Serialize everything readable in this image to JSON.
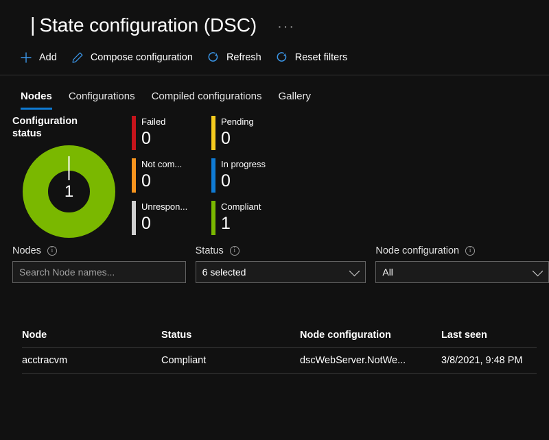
{
  "header": {
    "pipe": "|",
    "title": "State configuration (DSC)",
    "more_menu": "···"
  },
  "toolbar": {
    "items": [
      {
        "label": "Add",
        "icon": "plus-icon"
      },
      {
        "label": "Compose configuration",
        "icon": "pencil-icon"
      },
      {
        "label": "Refresh",
        "icon": "refresh-icon"
      },
      {
        "label": "Reset filters",
        "icon": "reset-icon"
      }
    ]
  },
  "tabs": [
    {
      "label": "Nodes",
      "active": true
    },
    {
      "label": "Configurations",
      "active": false
    },
    {
      "label": "Compiled configurations",
      "active": false
    },
    {
      "label": "Gallery",
      "active": false
    }
  ],
  "status_panel": {
    "heading": "Configuration status",
    "center_value": "1",
    "legend": [
      {
        "label": "Failed",
        "value": "0",
        "color": "#c5141b"
      },
      {
        "label": "Pending",
        "value": "0",
        "color": "#f5cb1e"
      },
      {
        "label": "Not com...",
        "value": "0",
        "color": "#f7941e"
      },
      {
        "label": "In progress",
        "value": "0",
        "color": "#0f7bd4"
      },
      {
        "label": "Unrespon...",
        "value": "0",
        "color": "#d0d0d0"
      },
      {
        "label": "Compliant",
        "value": "1",
        "color": "#7ab800"
      }
    ]
  },
  "chart_data": {
    "type": "pie",
    "title": "Configuration status",
    "categories": [
      "Failed",
      "Pending",
      "Not com...",
      "In progress",
      "Unrespon...",
      "Compliant"
    ],
    "values": [
      0,
      0,
      0,
      0,
      0,
      1
    ],
    "colors": [
      "#c5141b",
      "#f5cb1e",
      "#f7941e",
      "#0f7bd4",
      "#d0d0d0",
      "#7ab800"
    ],
    "total": 1,
    "center_label": "1",
    "donut": true,
    "legend_position": "right"
  },
  "filters": {
    "nodes": {
      "label": "Nodes",
      "info": "i",
      "placeholder": "Search Node names...",
      "value": ""
    },
    "status": {
      "label": "Status",
      "info": "i",
      "value": "6 selected"
    },
    "node_configuration": {
      "label": "Node configuration",
      "info": "i",
      "value": "All"
    }
  },
  "table": {
    "columns": [
      "Node",
      "Status",
      "Node configuration",
      "Last seen"
    ],
    "rows": [
      {
        "node": "acctracvm",
        "status": "Compliant",
        "node_configuration": "dscWebServer.NotWe...",
        "last_seen": "3/8/2021, 9:48 PM"
      }
    ]
  },
  "colors": {
    "background": "#111111",
    "accent": "#0f7bd4",
    "compliant_green": "#7ab800"
  }
}
